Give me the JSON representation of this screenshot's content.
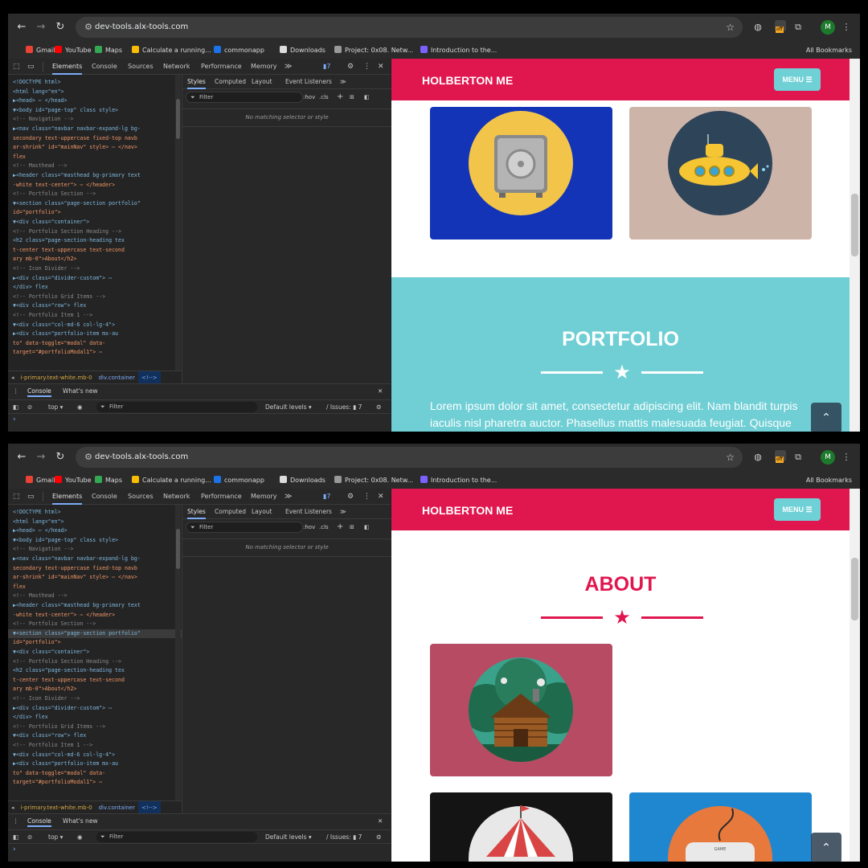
{
  "browser": {
    "url": "dev-tools.alx-tools.com",
    "extension_badge": "off",
    "avatar_letter": "M",
    "bookmarks": [
      {
        "label": "Gmail",
        "icon": "gmail-icon",
        "color": "#ea4335"
      },
      {
        "label": "YouTube",
        "icon": "youtube-icon",
        "color": "#ff0000"
      },
      {
        "label": "Maps",
        "icon": "maps-icon",
        "color": "#34a853"
      },
      {
        "label": "Calculate a running...",
        "icon": "drive-icon",
        "color": "#fbbc04"
      },
      {
        "label": "commonapp",
        "icon": "commonapp-icon",
        "color": "#1a73e8"
      },
      {
        "label": "Downloads",
        "icon": "download-icon",
        "color": "#dcdcdc"
      },
      {
        "label": "Project: 0x08. Netw...",
        "icon": "alx-icon",
        "color": "#999999"
      },
      {
        "label": "Introduction to the...",
        "icon": "udemy-icon",
        "color": "#7b61ff"
      }
    ],
    "all_bookmarks": "All Bookmarks"
  },
  "devtools": {
    "tabs": [
      "Elements",
      "Console",
      "Sources",
      "Network",
      "Performance",
      "Memory"
    ],
    "more": "≫",
    "issues_badge": "7",
    "styles_tabs": [
      "Styles",
      "Computed",
      "Layout",
      "Event Listeners"
    ],
    "styles_more": "≫",
    "filter_placeholder": "Filter",
    "hov": ":hov",
    "cls": ".cls",
    "no_match": "No matching selector or style",
    "breadcrumbs": [
      "i-primary.text-white.mb-0",
      "div.container",
      "<!-->"
    ],
    "console_tabs": [
      "Console",
      "What's new"
    ],
    "console_context": "top ▾",
    "console_filter": "Filter",
    "default_levels": "Default levels ▾",
    "issues_label": "/ Issues: ▮ 7",
    "prompt": "›",
    "dom_lines": [
      "<!DOCTYPE html>",
      "<html lang=\"en\">",
      "▶<head> ⋯ </head>",
      "▼<body id=\"page-top\" class style>",
      "  <!-- Navigation -->",
      "  ▶<nav class=\"navbar navbar-expand-lg bg-",
      "  secondary text-uppercase fixed-top navb",
      "  ar-shrink\" id=\"mainNav\" style> ⋯ </nav>",
      "  flex",
      "  <!-- Masthead -->",
      "  ▶<header class=\"masthead bg-primary text",
      "  -white text-center\"> ⋯ </header>",
      "  <!-- Portfolio Section -->",
      "  ▼<section class=\"page-section portfolio\"",
      "  id=\"portfolio\">",
      "    ▼<div class=\"container\">",
      "      <!-- Portfolio Section Heading -->",
      "      <h2 class=\"page-section-heading tex",
      "      t-center text-uppercase text-second",
      "      ary mb-0\">About</h2>",
      "      <!-- Icon Divider -->",
      "      ▶<div class=\"divider-custom\"> ⋯",
      "      </div> flex",
      "      <!-- Portfolio Grid Items -->",
      "      ▼<div class=\"row\"> flex",
      "        <!-- Portfolio Item 1 -->",
      "        ▼<div class=\"col-md-6 col-lg-4\">",
      "          ▶<div class=\"portfolio-item mx-au",
      "          to\" data-toggle=\"modal\" data-",
      "          target=\"#portfolioModal1\"> ⋯"
    ]
  },
  "site": {
    "brand": "HOLBERTON ME",
    "menu_label": "MENU ☰",
    "portfolio_title": "PORTFOLIO",
    "about_title": "ABOUT",
    "lorem": "Lorem ipsum dolor sit amet, consectetur adipiscing elit. Nam blandit turpis iaculis nisl pharetra auctor. Phasellus mattis malesuada feugiat. Quisque",
    "scroll_top": "⌃",
    "colors": {
      "primary": "#e0164e",
      "teal": "#6fcfd5",
      "safe_bg": "#1434b8",
      "submarine_bg": "#cdb4a8",
      "cabin_bg": "#b74b63",
      "circus_bg": "#141414",
      "game_bg": "#1f87d0"
    },
    "portfolio_items": [
      "safe",
      "submarine",
      "cabin",
      "circus",
      "game-controller"
    ],
    "controller_text": "GAME"
  }
}
